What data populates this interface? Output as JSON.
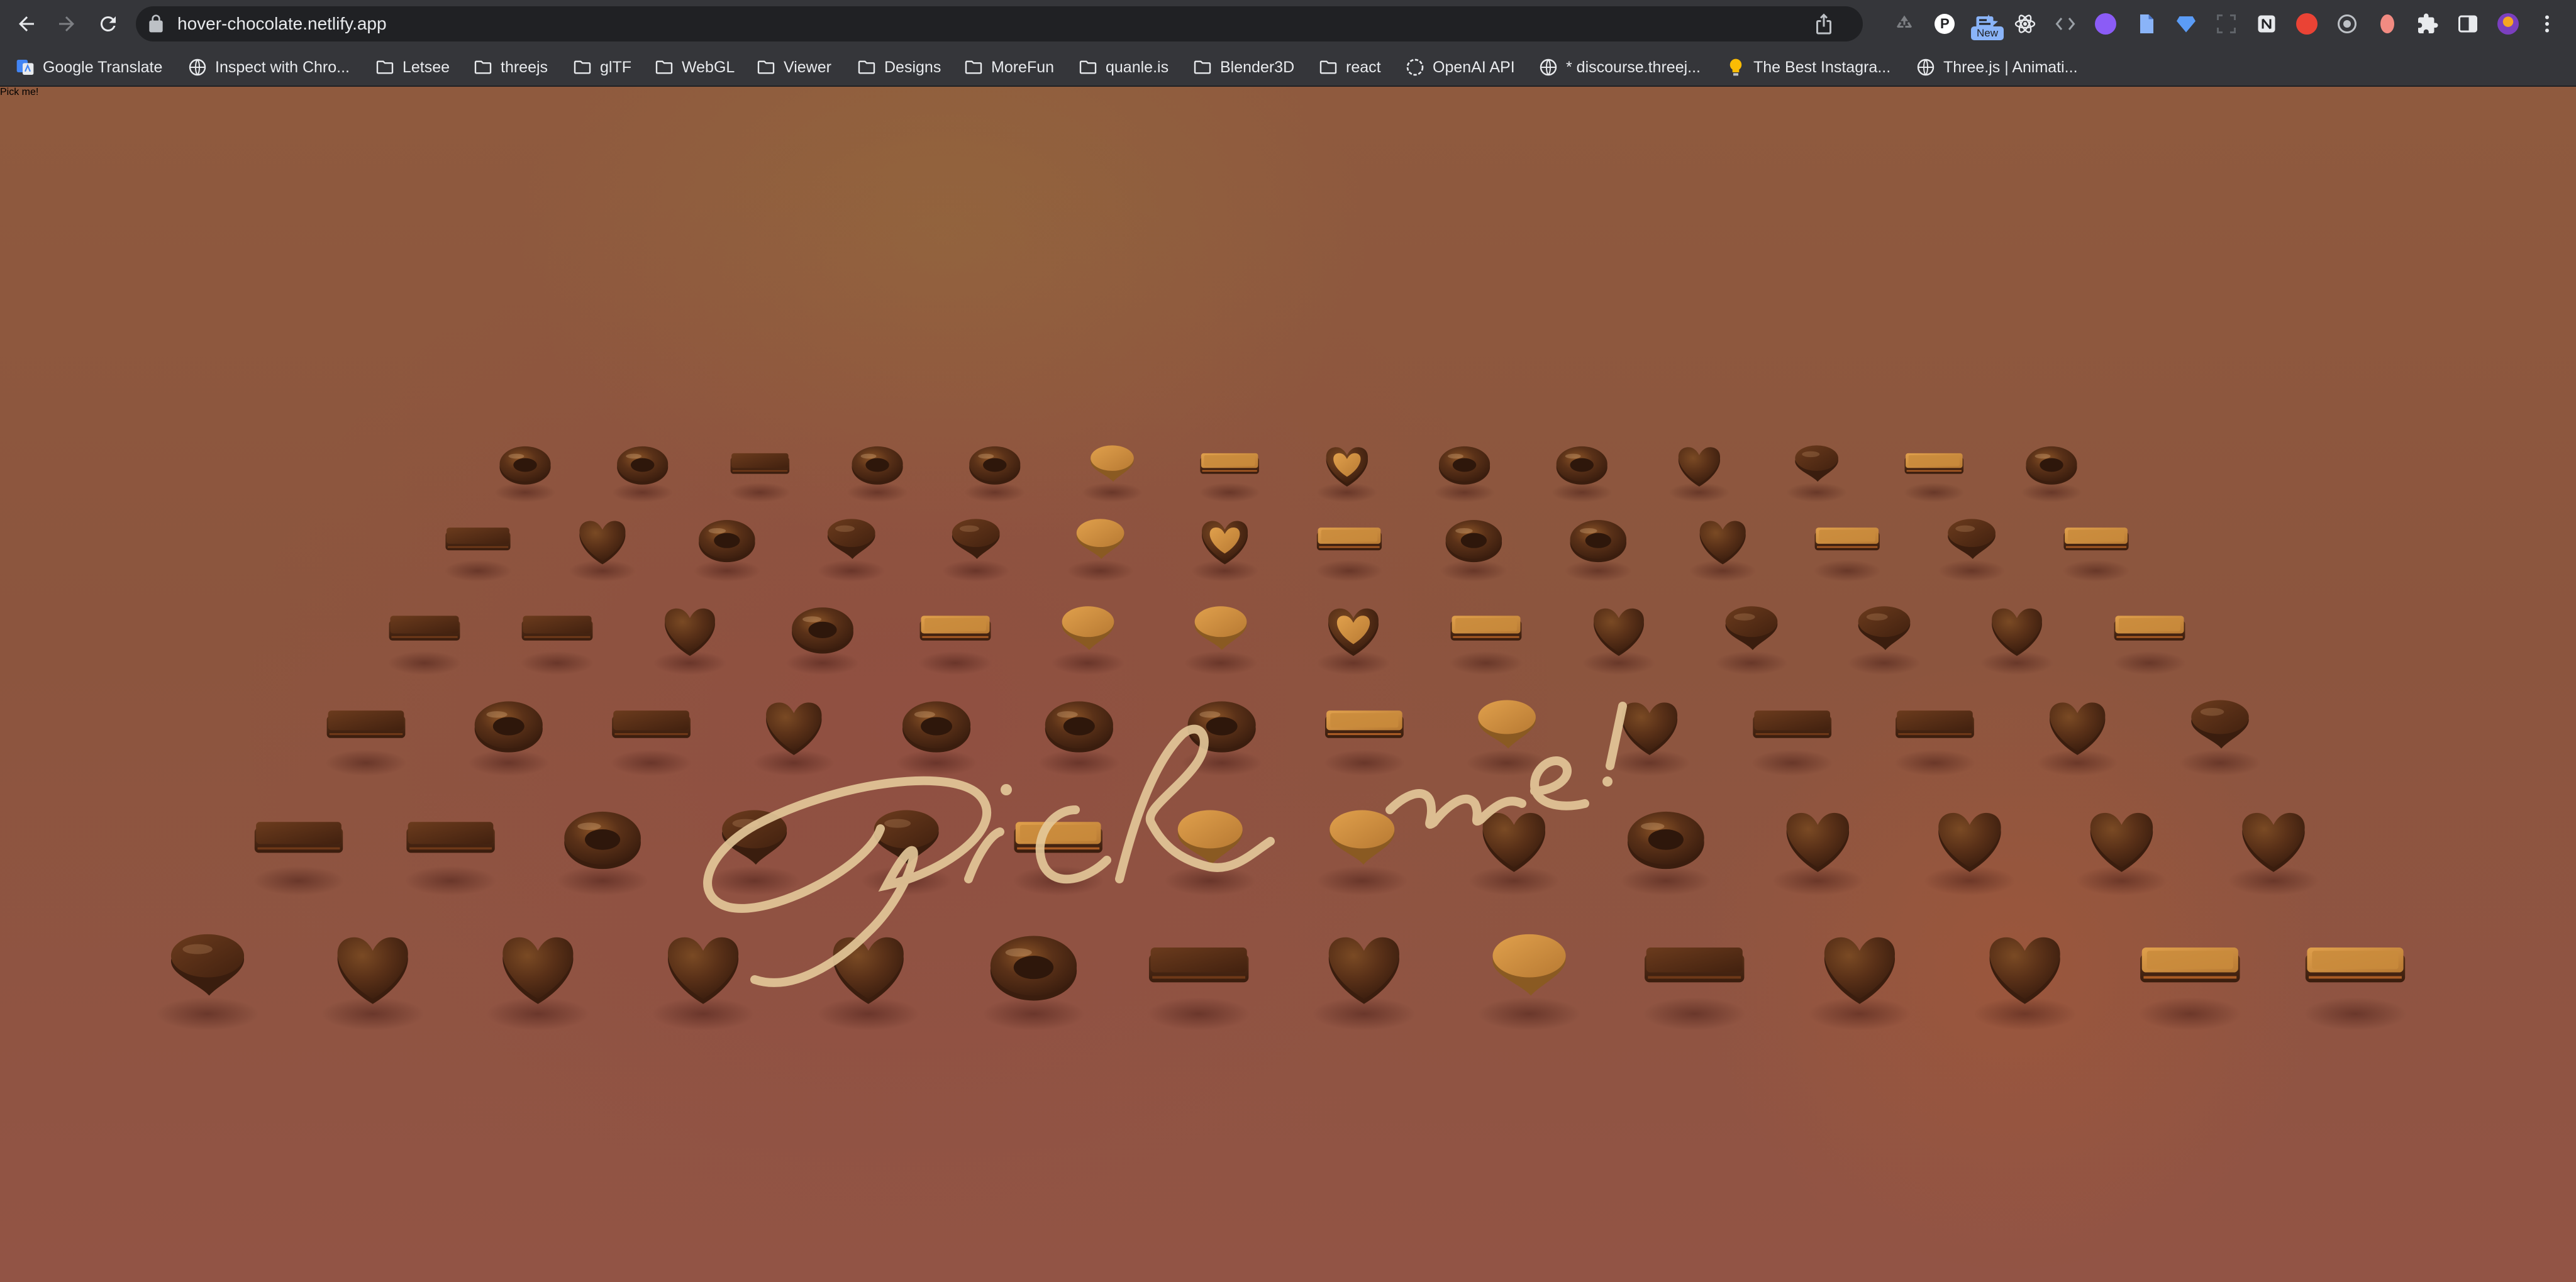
{
  "browser": {
    "url": "hover-chocolate.netlify.app",
    "new_badge": "New"
  },
  "bookmarks": [
    {
      "label": "Google Translate",
      "icon": "google-translate-icon"
    },
    {
      "label": "Inspect with Chro...",
      "icon": "globe-icon"
    },
    {
      "label": "Letsee",
      "icon": "folder-icon"
    },
    {
      "label": "threejs",
      "icon": "folder-icon"
    },
    {
      "label": "glTF",
      "icon": "folder-icon"
    },
    {
      "label": "WebGL",
      "icon": "folder-icon"
    },
    {
      "label": "Viewer",
      "icon": "folder-icon"
    },
    {
      "label": "Designs",
      "icon": "folder-icon"
    },
    {
      "label": "MoreFun",
      "icon": "folder-icon"
    },
    {
      "label": "quanle.is",
      "icon": "folder-icon"
    },
    {
      "label": "Blender3D",
      "icon": "folder-icon"
    },
    {
      "label": "react",
      "icon": "folder-icon"
    },
    {
      "label": "OpenAI API",
      "icon": "openai-icon"
    },
    {
      "label": "* discourse.threej...",
      "icon": "globe-icon"
    },
    {
      "label": "The Best Instagra...",
      "icon": "lightbulb-icon"
    },
    {
      "label": "Three.js | Animati...",
      "icon": "globe-icon"
    }
  ],
  "page": {
    "cursive_text": "Pick me!",
    "colors": {
      "chocolate_dark": "#3a1d0e",
      "chocolate_mid": "#5a3118",
      "chocolate_light": "#8a5326",
      "caramel": "#c98b3c",
      "script": "#e4c99a"
    },
    "chocolate_rows": [
      [
        "donut",
        "donut",
        "bar",
        "donut",
        "donut",
        "drop-lit",
        "bar-lit",
        "heart-lit",
        "donut",
        "donut",
        "heart",
        "drop",
        "bar-lit",
        "donut"
      ],
      [
        "bar",
        "heart",
        "donut",
        "drop",
        "drop",
        "drop-lit",
        "heart-lit",
        "bar-lit",
        "donut",
        "donut",
        "heart",
        "bar-lit",
        "drop",
        "bar-lit"
      ],
      [
        "bar",
        "bar",
        "heart",
        "donut",
        "bar-lit",
        "drop-lit",
        "drop-lit",
        "heart-lit",
        "bar-lit",
        "heart",
        "drop",
        "drop",
        "heart",
        "bar-lit"
      ],
      [
        "bar",
        "donut",
        "bar",
        "heart",
        "donut",
        "donut",
        "donut",
        "bar-lit",
        "drop-lit",
        "heart",
        "bar",
        "bar",
        "heart",
        "drop"
      ],
      [
        "bar",
        "bar",
        "donut",
        "drop",
        "drop",
        "bar-lit",
        "drop-lit",
        "drop-lit",
        "heart",
        "donut",
        "heart",
        "heart",
        "heart",
        "heart"
      ],
      [
        "drop",
        "heart",
        "heart",
        "heart",
        "heart",
        "donut",
        "bar",
        "heart",
        "drop-lit",
        "bar",
        "heart",
        "heart",
        "bar-lit",
        "bar-lit"
      ]
    ]
  }
}
